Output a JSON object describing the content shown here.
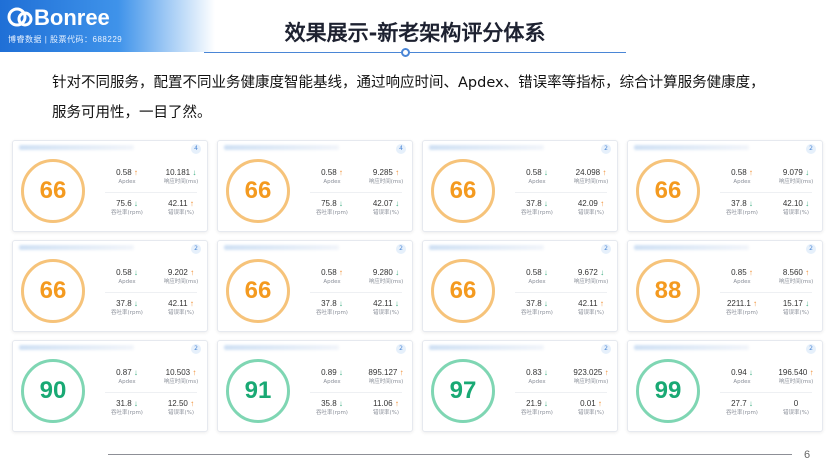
{
  "brand": {
    "name": "Bonree",
    "subtitle": "博睿数据 | 股票代码：688229",
    "color": "#1f6fd6"
  },
  "page": {
    "title": "效果展示-新老架构评分体系",
    "intro": "针对不同服务，配置不同业务健康度智能基线，通过响应时间、Apdex、错误率等指标，综合计算服务健康度，服务可用性，一目了然。",
    "number": "6"
  },
  "labels": {
    "apdex": "Apdex",
    "resp": "响应时间(ms)",
    "tput": "吞吐率(rpm)",
    "err": "错误率(%)"
  },
  "colors": {
    "warn_ring": "#f6c37a",
    "warn_text": "#f49a1f",
    "good_ring": "#7fd6b3",
    "good_text": "#19a974",
    "arrow_up": "#f08c2e",
    "arrow_down": "#3fae83"
  },
  "cards": [
    {
      "score": "66",
      "status": "warn",
      "badge": "4",
      "apdex": "0.58",
      "apdex_dir": "up",
      "resp": "10.181",
      "resp_dir": "down",
      "tput": "75.6",
      "tput_dir": "down",
      "err": "42.11",
      "err_dir": "up"
    },
    {
      "score": "66",
      "status": "warn",
      "badge": "4",
      "apdex": "0.58",
      "apdex_dir": "up",
      "resp": "9.285",
      "resp_dir": "up",
      "tput": "75.8",
      "tput_dir": "down",
      "err": "42.07",
      "err_dir": "down"
    },
    {
      "score": "66",
      "status": "warn",
      "badge": "2",
      "apdex": "0.58",
      "apdex_dir": "down",
      "resp": "24.098",
      "resp_dir": "up",
      "tput": "37.8",
      "tput_dir": "down",
      "err": "42.09",
      "err_dir": "up"
    },
    {
      "score": "66",
      "status": "warn",
      "badge": "2",
      "apdex": "0.58",
      "apdex_dir": "up",
      "resp": "9.079",
      "resp_dir": "down",
      "tput": "37.8",
      "tput_dir": "down",
      "err": "42.10",
      "err_dir": "down"
    },
    {
      "score": "66",
      "status": "warn",
      "badge": "2",
      "apdex": "0.58",
      "apdex_dir": "down",
      "resp": "9.202",
      "resp_dir": "up",
      "tput": "37.8",
      "tput_dir": "down",
      "err": "42.11",
      "err_dir": "up"
    },
    {
      "score": "66",
      "status": "warn",
      "badge": "2",
      "apdex": "0.58",
      "apdex_dir": "up",
      "resp": "9.280",
      "resp_dir": "down",
      "tput": "37.8",
      "tput_dir": "down",
      "err": "42.11",
      "err_dir": "down"
    },
    {
      "score": "66",
      "status": "warn",
      "badge": "2",
      "apdex": "0.58",
      "apdex_dir": "down",
      "resp": "9.672",
      "resp_dir": "down",
      "tput": "37.8",
      "tput_dir": "down",
      "err": "42.11",
      "err_dir": "up"
    },
    {
      "score": "88",
      "status": "warn",
      "badge": "2",
      "apdex": "0.85",
      "apdex_dir": "up",
      "resp": "8.560",
      "resp_dir": "up",
      "tput": "2211.1",
      "tput_dir": "up",
      "err": "15.17",
      "err_dir": "down"
    },
    {
      "score": "90",
      "status": "good",
      "badge": "2",
      "apdex": "0.87",
      "apdex_dir": "down",
      "resp": "10.503",
      "resp_dir": "up",
      "tput": "31.8",
      "tput_dir": "down",
      "err": "12.50",
      "err_dir": "up"
    },
    {
      "score": "91",
      "status": "good",
      "badge": "2",
      "apdex": "0.89",
      "apdex_dir": "down",
      "resp": "895.127",
      "resp_dir": "up",
      "tput": "35.8",
      "tput_dir": "down",
      "err": "11.06",
      "err_dir": "up"
    },
    {
      "score": "97",
      "status": "good",
      "badge": "2",
      "apdex": "0.83",
      "apdex_dir": "down",
      "resp": "923.025",
      "resp_dir": "up",
      "tput": "21.9",
      "tput_dir": "down",
      "err": "0.01",
      "err_dir": "up"
    },
    {
      "score": "99",
      "status": "good",
      "badge": "2",
      "apdex": "0.94",
      "apdex_dir": "down",
      "resp": "196.540",
      "resp_dir": "up",
      "tput": "27.7",
      "tput_dir": "down",
      "err": "0",
      "err_dir": ""
    }
  ]
}
